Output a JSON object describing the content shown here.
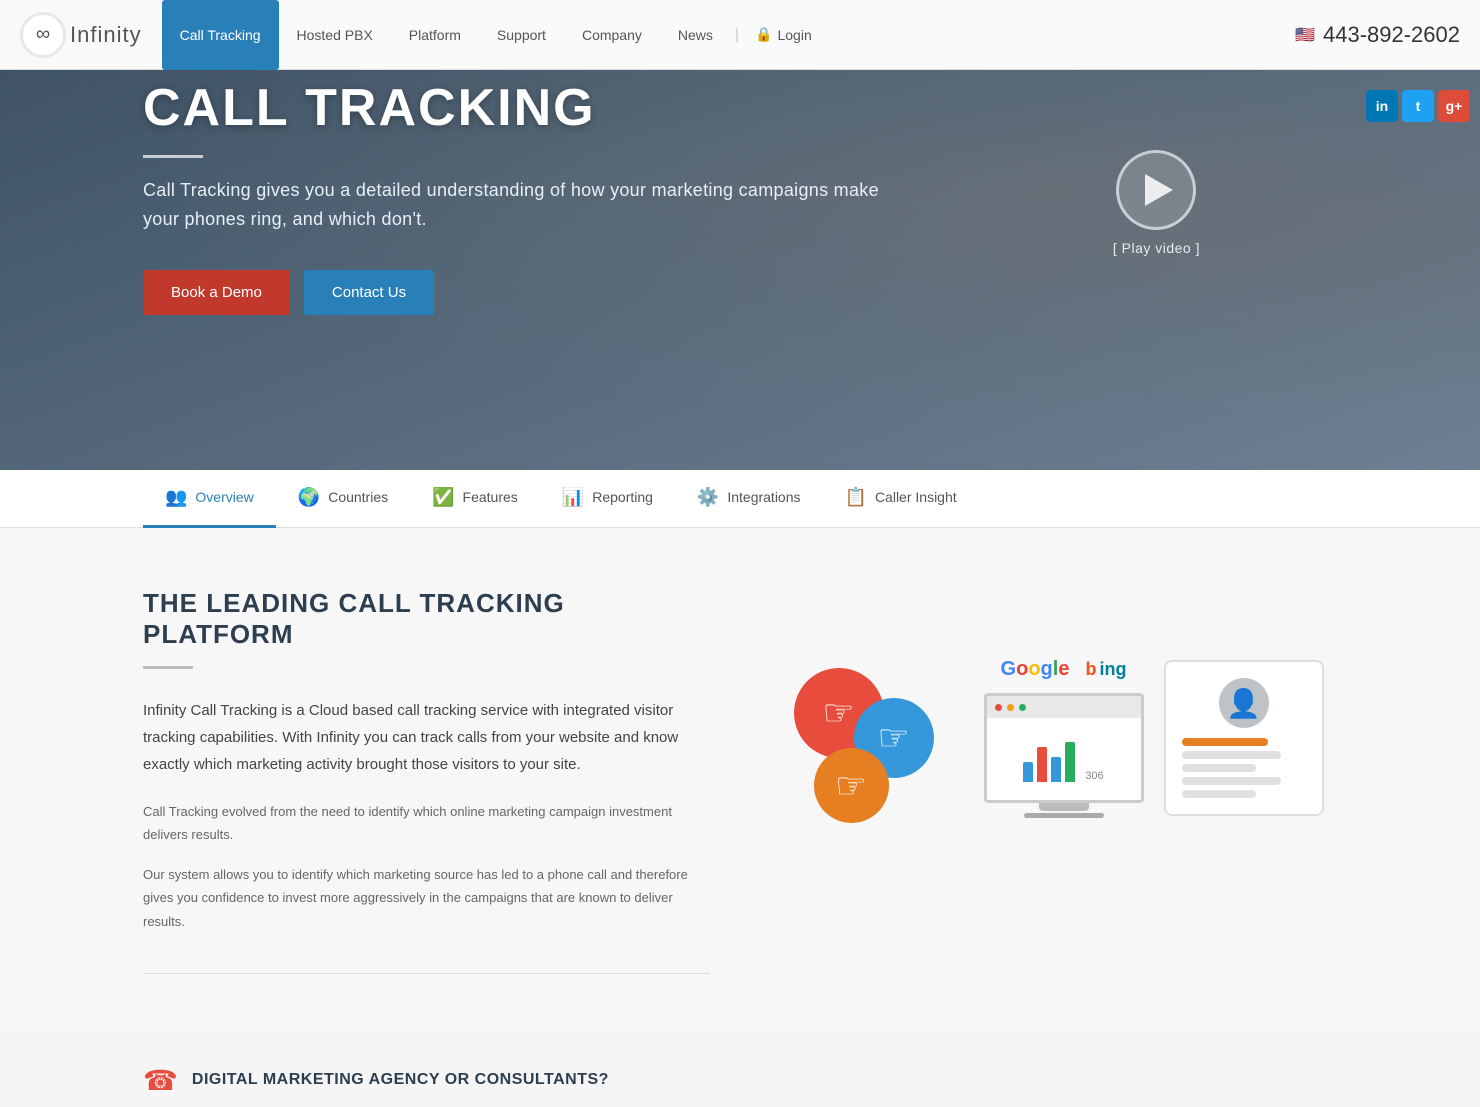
{
  "logo": {
    "symbol": "∞",
    "text": "Infinity"
  },
  "nav": {
    "links": [
      {
        "label": "Call Tracking",
        "active": true
      },
      {
        "label": "Hosted PBX",
        "active": false
      },
      {
        "label": "Platform",
        "active": false
      },
      {
        "label": "Support",
        "active": false
      },
      {
        "label": "Company",
        "active": false
      },
      {
        "label": "News",
        "active": false
      }
    ],
    "login_label": "Login",
    "phone": "443-892-2602"
  },
  "social": {
    "linkedin": "in",
    "twitter": "t",
    "google": "g+"
  },
  "hero": {
    "title": "CALL TRACKING",
    "subtitle": "Call Tracking gives you a detailed understanding of how your marketing campaigns make your phones ring, and which don't.",
    "btn_demo": "Book a Demo",
    "btn_contact": "Contact Us",
    "video_label": "[ Play video ]"
  },
  "tabs": [
    {
      "label": "Overview",
      "icon": "👥"
    },
    {
      "label": "Countries",
      "icon": "🌍"
    },
    {
      "label": "Features",
      "icon": "✅"
    },
    {
      "label": "Reporting",
      "icon": "📊"
    },
    {
      "label": "Integrations",
      "icon": "⚙️"
    },
    {
      "label": "Caller Insight",
      "icon": "📋"
    }
  ],
  "main": {
    "section_title": "THE LEADING CALL TRACKING PLATFORM",
    "lead_text": "Infinity Call Tracking is a Cloud based call tracking service with integrated visitor tracking capabilities. With Infinity you can track calls from your website and know exactly which marketing activity brought those visitors to your site.",
    "para1": "Call Tracking evolved from the need to identify which online marketing campaign investment delivers results.",
    "para2": "Our system allows you to identify which marketing source has led to a phone call and therefore gives you confidence to invest more aggressively in the campaigns that are known to deliver results."
  },
  "bottom": {
    "teaser_title": "Digital Marketing Agency or Consultants?"
  },
  "illustration": {
    "google_text": "Google",
    "bing_text": "bing",
    "monitor_number": "306"
  }
}
